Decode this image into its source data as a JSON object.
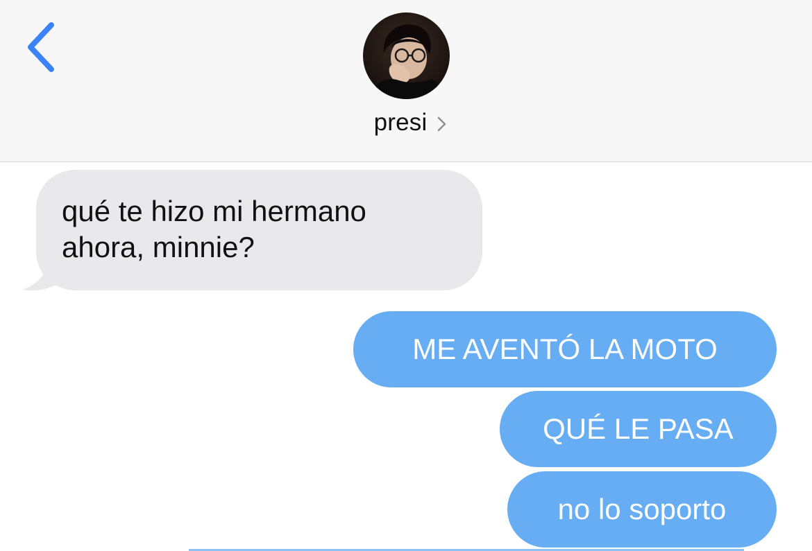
{
  "header": {
    "contact_name": "presi",
    "back_icon": "chevron-left-icon",
    "detail_icon": "chevron-right-icon",
    "accent_color": "#3b82f6"
  },
  "messages": [
    {
      "direction": "received",
      "lines": [
        "qué te hizo mi hermano",
        "ahora, minnie?"
      ]
    },
    {
      "direction": "sent",
      "text": "ME AVENTÓ LA MOTO"
    },
    {
      "direction": "sent",
      "text": "QUÉ LE PASA"
    },
    {
      "direction": "sent",
      "text": "no lo soporto"
    }
  ],
  "colors": {
    "header_bg": "#f7f7f8",
    "received_bubble": "#e9e9eb",
    "sent_bubble": "#66adf4",
    "sent_text": "#ffffff"
  }
}
